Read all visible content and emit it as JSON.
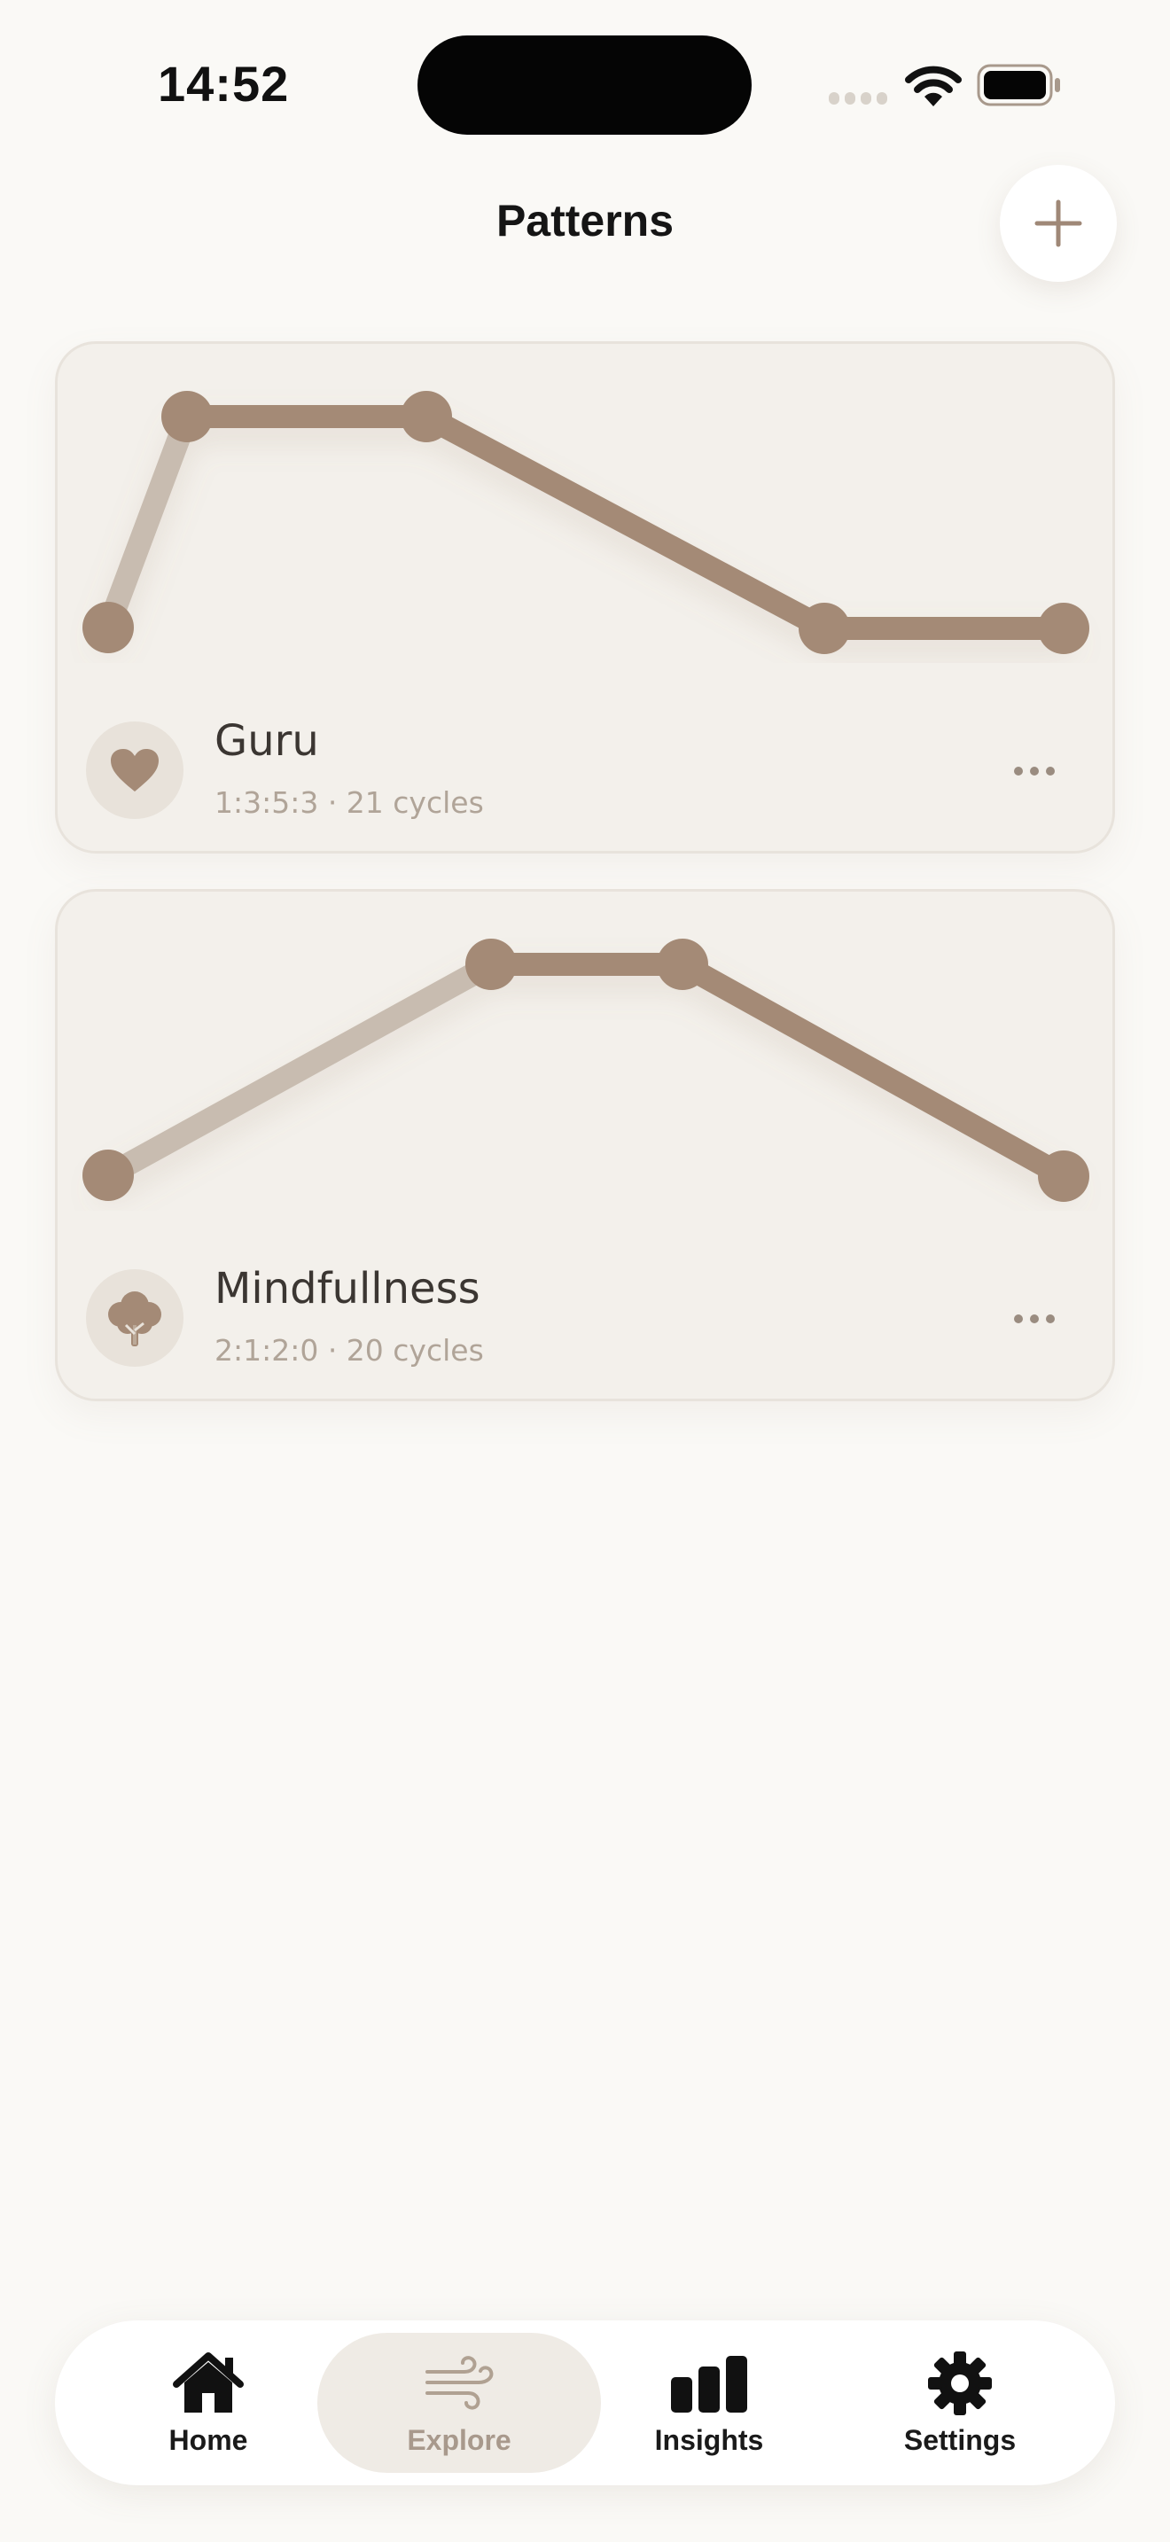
{
  "status_bar": {
    "time": "14:52"
  },
  "header": {
    "title": "Patterns",
    "add_icon": "plus-icon"
  },
  "patterns": [
    {
      "name": "Guru",
      "meta": "1:3:5:3 · 21 cycles",
      "icon": "heart-icon",
      "more_icon": "ellipsis-icon",
      "ratio": [
        1,
        3,
        5,
        3
      ]
    },
    {
      "name": "Mindfullness",
      "meta": "2:1:2:0 · 20 cycles",
      "icon": "tree-icon",
      "more_icon": "ellipsis-icon",
      "ratio": [
        2,
        1,
        2,
        0
      ]
    }
  ],
  "tab_bar": {
    "tabs": [
      {
        "label": "Home",
        "icon": "house-icon",
        "active": false
      },
      {
        "label": "Explore",
        "icon": "wind-icon",
        "active": true
      },
      {
        "label": "Insights",
        "icon": "bar-chart-icon",
        "active": false
      },
      {
        "label": "Settings",
        "icon": "gear-icon",
        "active": false
      }
    ]
  },
  "colors": {
    "accent": "#a48a76",
    "accent_light": "#c8bcb0",
    "background": "#faf9f6",
    "card": "#f3f0eb",
    "active_tab": "#efebe5"
  }
}
